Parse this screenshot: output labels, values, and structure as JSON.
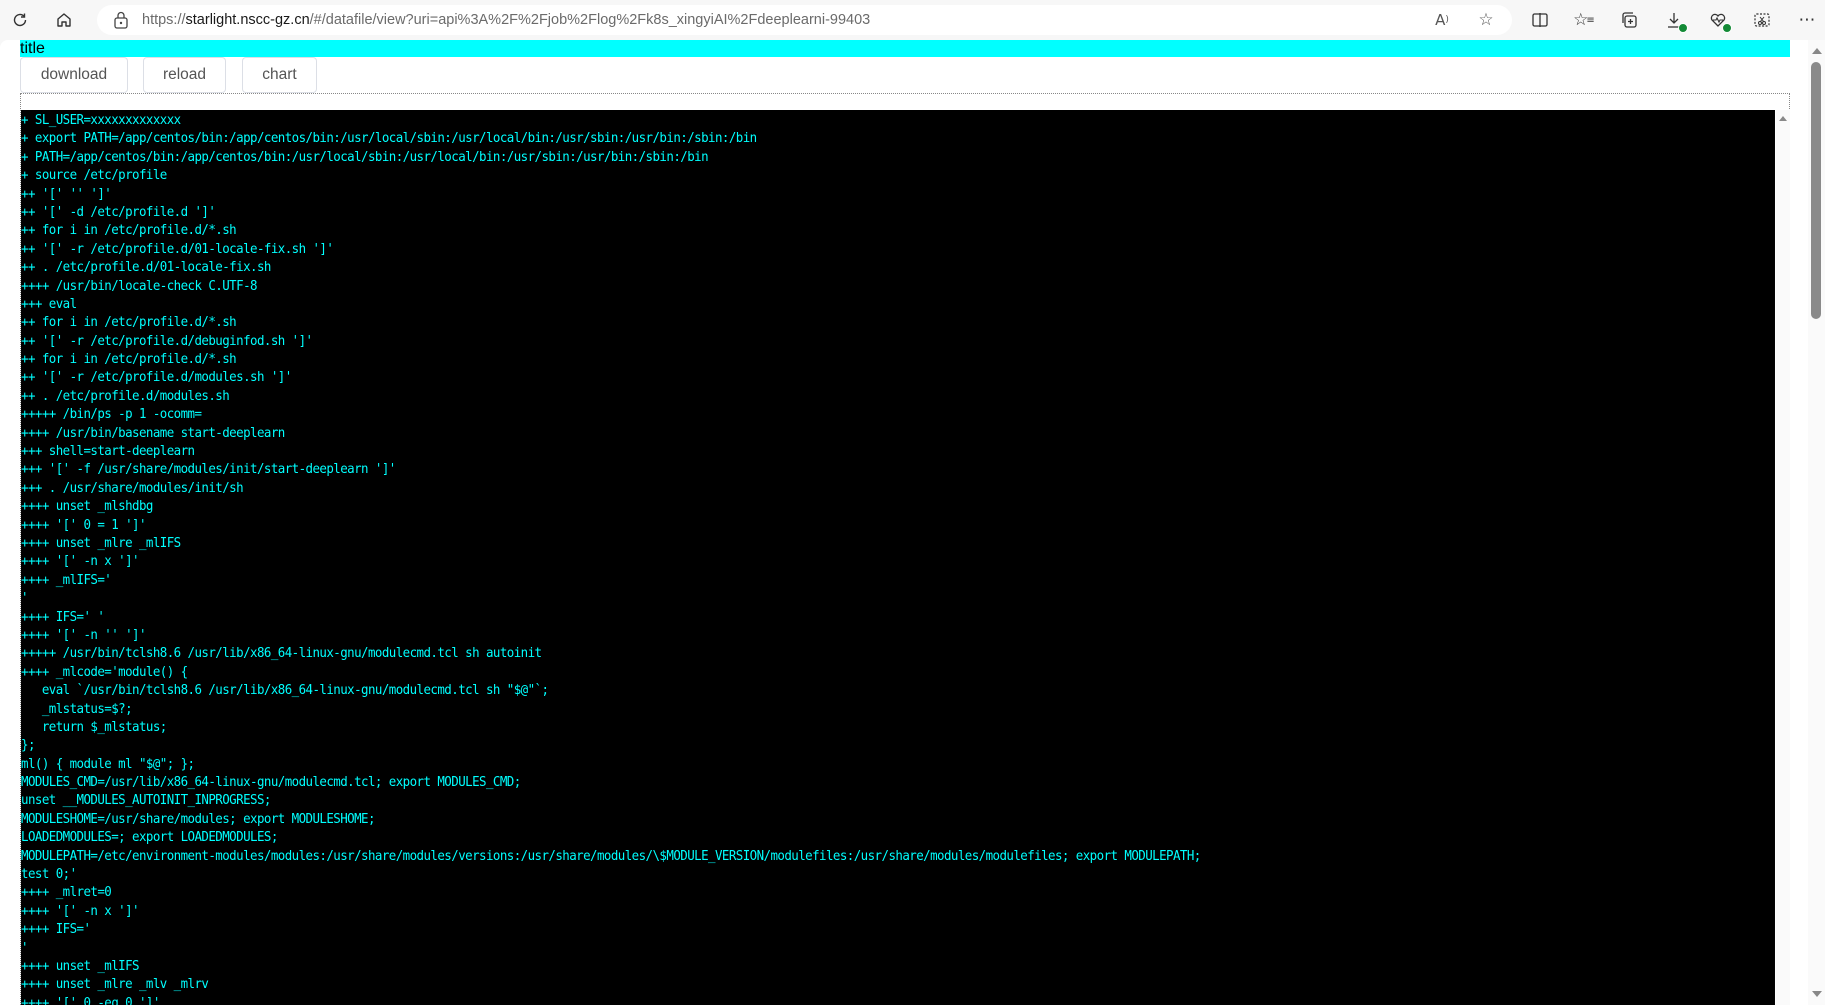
{
  "browser": {
    "url_prefix": "https://",
    "url_domain": "starlight.nscc-gz.cn",
    "url_rest": "/#/datafile/view?uri=api%3A%2F%2Fjob%2Flog%2Fk8s_xingyiAI%2Fdeeplearni-99403",
    "icons": {
      "refresh": "refresh-icon",
      "home": "home-icon",
      "lock": "lock-icon",
      "read_aloud": "read-aloud-icon",
      "favorite": "star-icon",
      "split_screen": "split-screen-icon",
      "favorites": "favorites-list-icon",
      "collections": "collections-icon",
      "downloads": "download-icon",
      "browser_essentials": "heart-pulse-icon",
      "screenshot": "screenshot-icon",
      "more": "more-icon"
    }
  },
  "page": {
    "title": "title",
    "buttons": {
      "download": "download",
      "reload": "reload",
      "chart": "chart"
    },
    "text_color": "#00ffff",
    "title_bg": "#00ffff",
    "log_bg": "#000000",
    "log_lines": [
      "+ SL_USER=xxxxxxxxxxxxx",
      "+ export PATH=/app/centos/bin:/app/centos/bin:/usr/local/sbin:/usr/local/bin:/usr/sbin:/usr/bin:/sbin:/bin",
      "+ PATH=/app/centos/bin:/app/centos/bin:/usr/local/sbin:/usr/local/bin:/usr/sbin:/usr/bin:/sbin:/bin",
      "+ source /etc/profile",
      "++ '[' '' ']'",
      "++ '[' -d /etc/profile.d ']'",
      "++ for i in /etc/profile.d/*.sh",
      "++ '[' -r /etc/profile.d/01-locale-fix.sh ']'",
      "++ . /etc/profile.d/01-locale-fix.sh",
      "++++ /usr/bin/locale-check C.UTF-8",
      "+++ eval",
      "++ for i in /etc/profile.d/*.sh",
      "++ '[' -r /etc/profile.d/debuginfod.sh ']'",
      "++ for i in /etc/profile.d/*.sh",
      "++ '[' -r /etc/profile.d/modules.sh ']'",
      "++ . /etc/profile.d/modules.sh",
      "+++++ /bin/ps -p 1 -ocomm=",
      "++++ /usr/bin/basename start-deeplearn",
      "+++ shell=start-deeplearn",
      "+++ '[' -f /usr/share/modules/init/start-deeplearn ']'",
      "+++ . /usr/share/modules/init/sh",
      "++++ unset _mlshdbg",
      "++++ '[' 0 = 1 ']'",
      "++++ unset _mlre _mlIFS",
      "++++ '[' -n x ']'",
      "++++ _mlIFS='",
      "'",
      "++++ IFS=' '",
      "++++ '[' -n '' ']'",
      "+++++ /usr/bin/tclsh8.6 /usr/lib/x86_64-linux-gnu/modulecmd.tcl sh autoinit",
      "++++ _mlcode='module() {",
      "   eval `/usr/bin/tclsh8.6 /usr/lib/x86_64-linux-gnu/modulecmd.tcl sh \"$@\"`;",
      "   _mlstatus=$?;",
      "   return $_mlstatus;",
      "};",
      "ml() { module ml \"$@\"; };",
      "MODULES_CMD=/usr/lib/x86_64-linux-gnu/modulecmd.tcl; export MODULES_CMD;",
      "unset __MODULES_AUTOINIT_INPROGRESS;",
      "MODULESHOME=/usr/share/modules; export MODULESHOME;",
      "LOADEDMODULES=; export LOADEDMODULES;",
      "MODULEPATH=/etc/environment-modules/modules:/usr/share/modules/versions:/usr/share/modules/\\$MODULE_VERSION/modulefiles:/usr/share/modules/modulefiles; export MODULEPATH;",
      "test 0;'",
      "++++ _mlret=0",
      "++++ '[' -n x ']'",
      "++++ IFS='",
      "'",
      "++++ unset _mlIFS",
      "++++ unset _mlre _mlv _mlrv",
      "++++ '[' 0 -eq 0 ']'"
    ]
  }
}
